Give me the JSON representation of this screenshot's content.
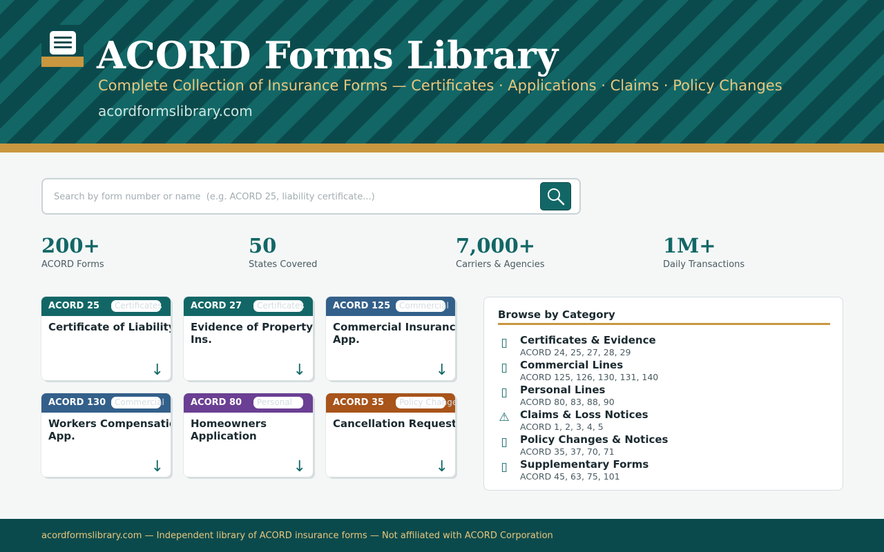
{
  "header": {
    "title": "ACORD Forms Library",
    "subtitle": "Complete Collection of Insurance Forms  —  Certificates · Applications · Claims · Policy Changes",
    "domain": "acordformslibrary.com",
    "logo_icon": "document-icon"
  },
  "search": {
    "placeholder": "Search by form number or name  (e.g. ACORD 25, liability certificate...)",
    "button_icon": "search-icon"
  },
  "stats": [
    {
      "value": "200+",
      "label": "ACORD Forms"
    },
    {
      "value": "50",
      "label": "States Covered"
    },
    {
      "value": "7,000+",
      "label": "Carriers & Agencies"
    },
    {
      "value": "1M+",
      "label": "Daily Transactions"
    }
  ],
  "forms": [
    {
      "number": "ACORD 25",
      "category": "Certificates",
      "name": "Certificate of Liability",
      "color": "#126766",
      "download_icon": "↓"
    },
    {
      "number": "ACORD 27",
      "category": "Certificates",
      "name": "Evidence of Property Ins.",
      "color": "#126766",
      "download_icon": "↓"
    },
    {
      "number": "ACORD 125",
      "category": "Commercial",
      "name": "Commercial Insurance App.",
      "color": "#33608a",
      "download_icon": "↓"
    },
    {
      "number": "ACORD 130",
      "category": "Commercial",
      "name": "Workers Compensation App.",
      "color": "#33608a",
      "download_icon": "↓"
    },
    {
      "number": "ACORD 80",
      "category": "Personal",
      "name": "Homeowners Application",
      "color": "#6b3f93",
      "download_icon": "↓"
    },
    {
      "number": "ACORD 35",
      "category": "Policy Changes",
      "name": "Cancellation Request",
      "color": "#a8541a",
      "download_icon": "↓"
    }
  ],
  "categories": {
    "title": "Browse by Category",
    "items": [
      {
        "name": "Certificates & Evidence",
        "forms": "ACORD 24, 25, 27, 28, 29",
        "icon": "▯"
      },
      {
        "name": "Commercial Lines",
        "forms": "ACORD 125, 126, 130, 131, 140",
        "icon": "▯"
      },
      {
        "name": "Personal Lines",
        "forms": "ACORD 80, 83, 88, 90",
        "icon": "▯"
      },
      {
        "name": "Claims & Loss Notices",
        "forms": "ACORD 1, 2, 3, 4, 5",
        "icon": "⚠"
      },
      {
        "name": "Policy Changes & Notices",
        "forms": "ACORD 35, 37, 70, 71",
        "icon": "▯"
      },
      {
        "name": "Supplementary Forms",
        "forms": "ACORD 45, 63, 75, 101",
        "icon": "▯"
      }
    ]
  },
  "footer": {
    "text": "acordformslibrary.com  —  Independent library of ACORD insurance forms  —  Not affiliated with ACORD Corporation"
  }
}
